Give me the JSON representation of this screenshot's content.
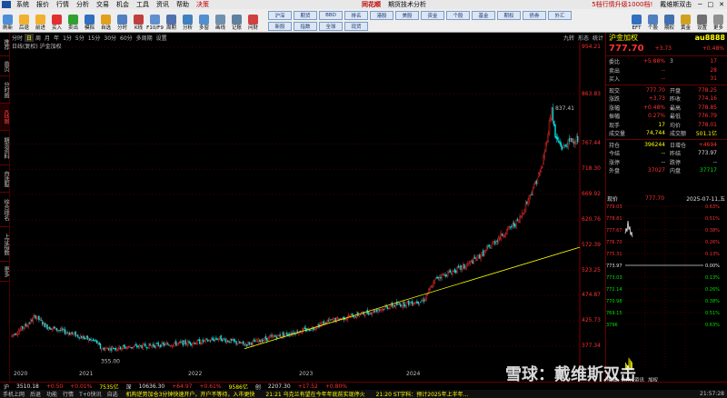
{
  "menubar": {
    "items": [
      "系统",
      "报价",
      "行情",
      "分析",
      "交易",
      "机会",
      "工具",
      "资讯",
      "帮助"
    ],
    "special": "决策",
    "brand": "同花顺",
    "subtitle": "期货技术分析",
    "promo": "5档行情升级1000档!",
    "promo2": "戴维斯双击"
  },
  "toolbar": {
    "buttons": [
      "刷新",
      "后退",
      "前进",
      "买入",
      "卖出",
      "模拟",
      "自选",
      "分时",
      "K线",
      "F10/F9",
      "周期",
      "分析",
      "多窗",
      "画线",
      "记账",
      "问财"
    ],
    "grid": [
      "沪深",
      "期货",
      "BBD",
      "排名",
      "港股",
      "美股",
      "资金",
      "个股",
      "基金",
      "期权",
      "债券",
      "外汇",
      "新股",
      "指数",
      "全球",
      "现货"
    ],
    "right_buttons": [
      "EFT",
      "个股",
      "期权",
      "黄金",
      "设置",
      "更多"
    ]
  },
  "sidebar": {
    "tabs": [
      "推荐",
      "首页",
      "分时图",
      "K线图",
      "期货资料",
      "自选股",
      "综合排名",
      "上证指数",
      "更多"
    ],
    "active_index": 3
  },
  "period": {
    "items": [
      "分时",
      "日",
      "周",
      "月",
      "年",
      "1分",
      "5分",
      "15分",
      "30分",
      "60分",
      "多周期",
      "设置"
    ],
    "active_index": 1,
    "right": [
      "九转",
      "形态",
      "统计"
    ]
  },
  "chart_label": "日线(复权)  沪金加权",
  "chart_data": {
    "type": "candlestick",
    "y_ticks": [
      954.21,
      863.83,
      767.44,
      718.3,
      669.92,
      620.76,
      572.39,
      523.25,
      474.87,
      425.73,
      377.34
    ],
    "x_labels": [
      "2020",
      "2021",
      "2022",
      "2023",
      "2024"
    ],
    "annotations": [
      {
        "label": "837.41"
      },
      {
        "label": "355.00"
      }
    ]
  },
  "quote": {
    "name": "沪金加权",
    "code": "au8888",
    "price": "777.70",
    "change": "+3.73",
    "pct": "+0.48%",
    "rows": [
      {
        "k": "委比",
        "v": "+5.88%",
        "k2": "3",
        "v2": "17"
      },
      {
        "k": "卖出",
        "v": "--",
        "k2": "",
        "v2": "28"
      },
      {
        "k": "买入",
        "v": "--",
        "k2": "",
        "v2": "31"
      },
      {
        "k": "现交",
        "v": "777.70",
        "k2": "开盘",
        "v2": "778.25"
      },
      {
        "k": "涨跌",
        "v": "+3.73",
        "k2": "昨收",
        "v2": "774.16"
      },
      {
        "k": "涨幅",
        "v": "+0.48%",
        "k2": "最高",
        "v2": "778.85"
      },
      {
        "k": "振幅",
        "v": "0.27%",
        "k2": "最低",
        "v2": "776.79"
      },
      {
        "k": "现手",
        "v": "17",
        "k2": "均价",
        "v2": "778.01"
      },
      {
        "k": "成交量",
        "v": "74,744",
        "k2": "成交额",
        "v2": "501.1亿"
      },
      {
        "k": "持仓",
        "v": "396244",
        "k2": "日增仓",
        "v2": "+4694"
      },
      {
        "k": "今结",
        "v": "--",
        "k2": "昨结",
        "v2": "773.97"
      },
      {
        "k": "涨停",
        "v": "--",
        "k2": "跌停",
        "v2": "--"
      },
      {
        "k": "外盘",
        "v": "37027",
        "k2": "内盘",
        "v2": "37717"
      }
    ]
  },
  "mini": {
    "label": "现价",
    "price": "777.70",
    "date": "2025-07-11,五",
    "left_ticks": [
      "779.03",
      "778.81",
      "777.67",
      "776.70",
      "775.31",
      "773.97",
      "773.03",
      "772.14",
      "770.98",
      "769.15",
      "3796",
      "1897"
    ],
    "right_ticks": [
      "0.63%",
      "0.51%",
      "0.38%",
      "0.26%",
      "0.13%",
      "0.00%",
      "0.13%",
      "0.26%",
      "0.38%",
      "0.51%",
      "0.63%"
    ],
    "tabs": [
      "明细",
      "价格",
      "资讯",
      "加权"
    ]
  },
  "statusbar": {
    "items": [
      "沪",
      "3510.18",
      "+0.50",
      "+0.01%",
      "7535亿",
      "深",
      "10636.30",
      "+64.97",
      "+0.61%",
      "9586亿",
      "创",
      "2207.30",
      "+17.52",
      "+0.80%"
    ]
  },
  "bottombar": {
    "items": [
      "手机上网",
      "后退",
      "功能",
      "行情",
      "T+0快讯",
      "自选"
    ],
    "news": [
      "机构逆势加仓3分钟快速开户，开户不等待，入市更快",
      "21:21 乌克兰有望在今年年底前实现停火",
      "21:20 ST宇科：预计2025年上半年..."
    ],
    "time": "21:57:28"
  },
  "watermark": "雪球：戴维斯双击"
}
